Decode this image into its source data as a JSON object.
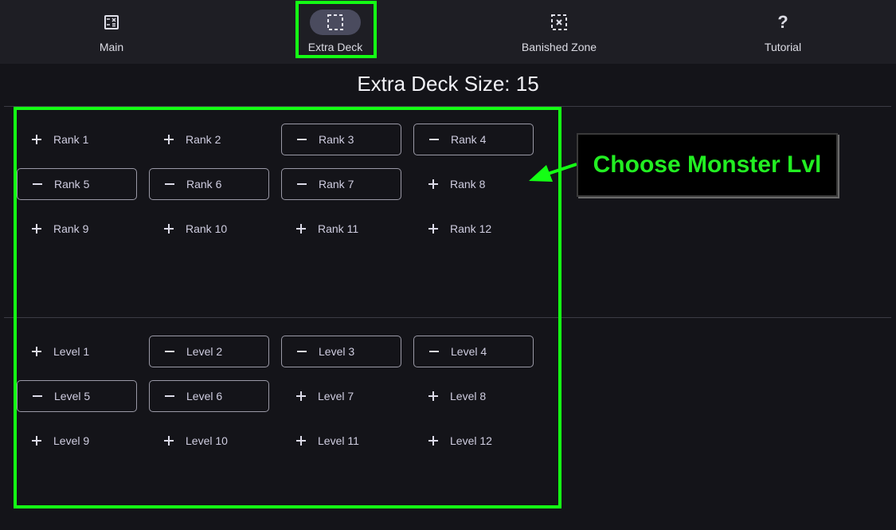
{
  "nav": {
    "items": [
      {
        "label": "Main",
        "icon": "calculator-icon"
      },
      {
        "label": "Extra Deck",
        "icon": "dashed-square-icon",
        "active": true
      },
      {
        "label": "Banished Zone",
        "icon": "dashed-x-square-icon"
      },
      {
        "label": "Tutorial",
        "icon": "question-icon",
        "symbol": "?"
      }
    ]
  },
  "page": {
    "title": "Extra Deck Size: 15"
  },
  "rank_chips": [
    {
      "label": "Rank 1",
      "selected": false
    },
    {
      "label": "Rank 2",
      "selected": false
    },
    {
      "label": "Rank 3",
      "selected": true
    },
    {
      "label": "Rank 4",
      "selected": true
    },
    {
      "label": "Rank 5",
      "selected": true
    },
    {
      "label": "Rank 6",
      "selected": true
    },
    {
      "label": "Rank 7",
      "selected": true
    },
    {
      "label": "Rank 8",
      "selected": false
    },
    {
      "label": "Rank 9",
      "selected": false
    },
    {
      "label": "Rank 10",
      "selected": false
    },
    {
      "label": "Rank 11",
      "selected": false
    },
    {
      "label": "Rank 12",
      "selected": false
    }
  ],
  "level_chips": [
    {
      "label": "Level 1",
      "selected": false
    },
    {
      "label": "Level 2",
      "selected": true
    },
    {
      "label": "Level 3",
      "selected": true
    },
    {
      "label": "Level 4",
      "selected": true
    },
    {
      "label": "Level 5",
      "selected": true
    },
    {
      "label": "Level 6",
      "selected": true
    },
    {
      "label": "Level 7",
      "selected": false
    },
    {
      "label": "Level 8",
      "selected": false
    },
    {
      "label": "Level 9",
      "selected": false
    },
    {
      "label": "Level 10",
      "selected": false
    },
    {
      "label": "Level 11",
      "selected": false
    },
    {
      "label": "Level 12",
      "selected": false
    }
  ],
  "annotation": {
    "callout": "Choose Monster Lvl",
    "color": "#14ff14"
  },
  "colors": {
    "background": "#141419",
    "navbar": "#1e1e24",
    "active_pill": "#4a4b5e"
  }
}
